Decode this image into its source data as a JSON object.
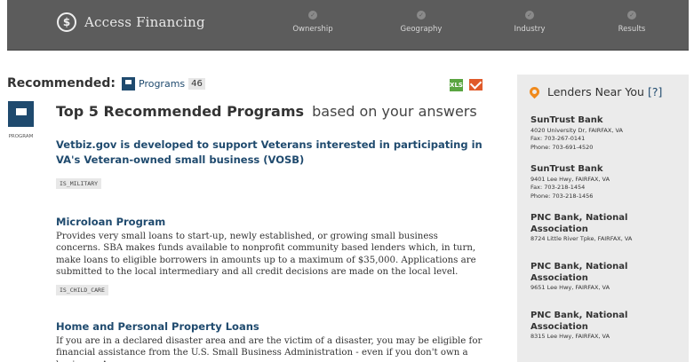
{
  "header": {
    "brand_icon": "$",
    "title": "Access Financing",
    "steps": [
      {
        "label": "Ownership",
        "icon": "check-icon"
      },
      {
        "label": "Geography",
        "icon": "check-icon"
      },
      {
        "label": "Industry",
        "icon": "check-icon"
      },
      {
        "label": "Results",
        "icon": "check-icon"
      }
    ],
    "step_check": "✓"
  },
  "recommended": {
    "label": "Recommended:",
    "tab_label": "Programs",
    "tab_count": "46",
    "export_label": "XLS"
  },
  "program_icon_label": "PROGRAM",
  "main": {
    "title_strong": "Top 5 Recommended Programs",
    "title_light": "based on your answers",
    "programs": [
      {
        "title": "Vetbiz.gov is developed to support Veterans interested in participating in VA's Veteran-owned small business (VOSB)",
        "desc": "",
        "tag": "IS_MILITARY"
      },
      {
        "title": "Microloan Program",
        "desc": "Provides very small loans to start-up, newly established, or growing small business concerns. SBA makes funds available to nonprofit community based lenders which, in turn, make loans to eligible borrowers in amounts up to a maximum of $35,000. Applications are submitted to the local intermediary and all credit decisions are made on the local level.",
        "tag": "IS_CHILD_CARE"
      },
      {
        "title": "Home and Personal Property Loans",
        "desc": "If you are in a declared disaster area and are the victim of a disaster, you may be eligible for financial assistance from the U.S. Small Business Administration - even if you don't own a business. As a",
        "tag": ""
      }
    ]
  },
  "sidebar": {
    "title": "Lenders Near You",
    "help": "[?]",
    "lenders": [
      {
        "name": "SunTrust Bank",
        "address": "4020 University Dr, FAIRFAX, VA",
        "fax": "Fax:  703-267-0141",
        "phone": "Phone:  703-691-4520"
      },
      {
        "name": "SunTrust Bank",
        "address": "9401 Lee Hwy, FAIRFAX, VA",
        "fax": "Fax:  703-218-1454",
        "phone": "Phone:  703-218-1456"
      },
      {
        "name": "PNC Bank, National Association",
        "address": "8724 Little River Tpke, FAIRFAX, VA",
        "fax": "",
        "phone": ""
      },
      {
        "name": "PNC Bank, National Association",
        "address": "9651 Lee Hwy, FAIRFAX, VA",
        "fax": "",
        "phone": ""
      },
      {
        "name": "PNC Bank, National Association",
        "address": "8315 Lee Hwy, FAIRFAX, VA",
        "fax": "",
        "phone": ""
      }
    ]
  }
}
